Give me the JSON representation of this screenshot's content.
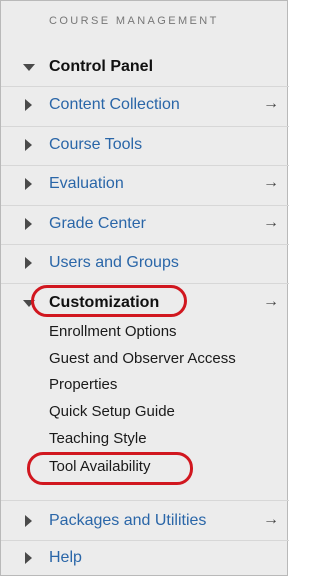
{
  "panel": {
    "section_header": "COURSE MANAGEMENT",
    "control_panel_label": "Control Panel",
    "items": [
      {
        "label": "Content Collection",
        "arrow": "→"
      },
      {
        "label": "Course Tools",
        "arrow": ""
      },
      {
        "label": "Evaluation",
        "arrow": "→"
      },
      {
        "label": "Grade Center",
        "arrow": "→"
      },
      {
        "label": "Users and Groups",
        "arrow": ""
      }
    ],
    "customization": {
      "label": "Customization",
      "arrow": "→",
      "subitems": [
        "Enrollment Options",
        "Guest and Observer Access",
        "Properties",
        "Quick Setup Guide",
        "Teaching Style",
        "Tool Availability"
      ]
    },
    "bottom_items": [
      {
        "label": "Packages and Utilities",
        "arrow": "→"
      },
      {
        "label": "Help",
        "arrow": ""
      }
    ],
    "highlight_color": "#d1171f",
    "link_color": "#2a66a8"
  }
}
